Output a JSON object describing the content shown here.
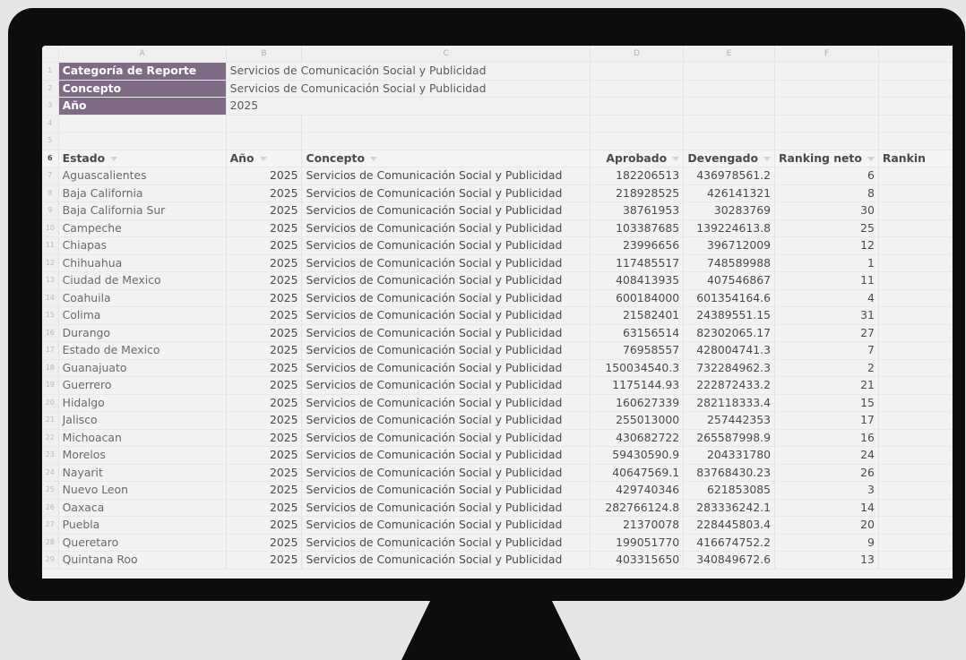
{
  "columns": [
    "A",
    "B",
    "C",
    "D",
    "E",
    "F"
  ],
  "meta": [
    {
      "label": "Categoría de Reporte",
      "value": "Servicios de Comunicación Social y Publicidad"
    },
    {
      "label": "Concepto",
      "value": "Servicios de Comunicación Social y Publicidad"
    },
    {
      "label": "Año",
      "value": "2025"
    }
  ],
  "header": [
    "Estado",
    "Año",
    "Concepto",
    "Aprobado",
    "Devengado",
    "Ranking neto",
    "Rankin"
  ],
  "row_numbers": [
    "1",
    "2",
    "3",
    "4",
    "5",
    "6",
    "7",
    "8",
    "9",
    "10",
    "11",
    "12",
    "13",
    "14",
    "15",
    "16",
    "17",
    "18",
    "19",
    "20",
    "21",
    "22",
    "23",
    "24",
    "25",
    "26",
    "27",
    "28",
    "29"
  ],
  "rows": [
    [
      "Aguascalientes",
      "2025",
      "Servicios de Comunicación Social y Publicidad",
      "182206513",
      "436978561.2",
      "6"
    ],
    [
      "Baja California",
      "2025",
      "Servicios de Comunicación Social y Publicidad",
      "218928525",
      "426141321",
      "8"
    ],
    [
      "Baja California Sur",
      "2025",
      "Servicios de Comunicación Social y Publicidad",
      "38761953",
      "30283769",
      "30"
    ],
    [
      "Campeche",
      "2025",
      "Servicios de Comunicación Social y Publicidad",
      "103387685",
      "139224613.8",
      "25"
    ],
    [
      "Chiapas",
      "2025",
      "Servicios de Comunicación Social y Publicidad",
      "23996656",
      "396712009",
      "12"
    ],
    [
      "Chihuahua",
      "2025",
      "Servicios de Comunicación Social y Publicidad",
      "117485517",
      "748589988",
      "1"
    ],
    [
      "Ciudad de Mexico",
      "2025",
      "Servicios de Comunicación Social y Publicidad",
      "408413935",
      "407546867",
      "11"
    ],
    [
      "Coahuila",
      "2025",
      "Servicios de Comunicación Social y Publicidad",
      "600184000",
      "601354164.6",
      "4"
    ],
    [
      "Colima",
      "2025",
      "Servicios de Comunicación Social y Publicidad",
      "21582401",
      "24389551.15",
      "31"
    ],
    [
      "Durango",
      "2025",
      "Servicios de Comunicación Social y Publicidad",
      "63156514",
      "82302065.17",
      "27"
    ],
    [
      "Estado de Mexico",
      "2025",
      "Servicios de Comunicación Social y Publicidad",
      "76958557",
      "428004741.3",
      "7"
    ],
    [
      "Guanajuato",
      "2025",
      "Servicios de Comunicación Social y Publicidad",
      "150034540.3",
      "732284962.3",
      "2"
    ],
    [
      "Guerrero",
      "2025",
      "Servicios de Comunicación Social y Publicidad",
      "1175144.93",
      "222872433.2",
      "21"
    ],
    [
      "Hidalgo",
      "2025",
      "Servicios de Comunicación Social y Publicidad",
      "160627339",
      "282118333.4",
      "15"
    ],
    [
      "Jalisco",
      "2025",
      "Servicios de Comunicación Social y Publicidad",
      "255013000",
      "257442353",
      "17"
    ],
    [
      "Michoacan",
      "2025",
      "Servicios de Comunicación Social y Publicidad",
      "430682722",
      "265587998.9",
      "16"
    ],
    [
      "Morelos",
      "2025",
      "Servicios de Comunicación Social y Publicidad",
      "59430590.9",
      "204331780",
      "24"
    ],
    [
      "Nayarit",
      "2025",
      "Servicios de Comunicación Social y Publicidad",
      "40647569.1",
      "83768430.23",
      "26"
    ],
    [
      "Nuevo Leon",
      "2025",
      "Servicios de Comunicación Social y Publicidad",
      "429740346",
      "621853085",
      "3"
    ],
    [
      "Oaxaca",
      "2025",
      "Servicios de Comunicación Social y Publicidad",
      "282766124.8",
      "283336242.1",
      "14"
    ],
    [
      "Puebla",
      "2025",
      "Servicios de Comunicación Social y Publicidad",
      "21370078",
      "228445803.4",
      "20"
    ],
    [
      "Queretaro",
      "2025",
      "Servicios de Comunicación Social y Publicidad",
      "199051770",
      "416674752.2",
      "9"
    ],
    [
      "Quintana Roo",
      "2025",
      "Servicios de Comunicación Social y Publicidad",
      "403315650",
      "340849672.6",
      "13"
    ]
  ]
}
